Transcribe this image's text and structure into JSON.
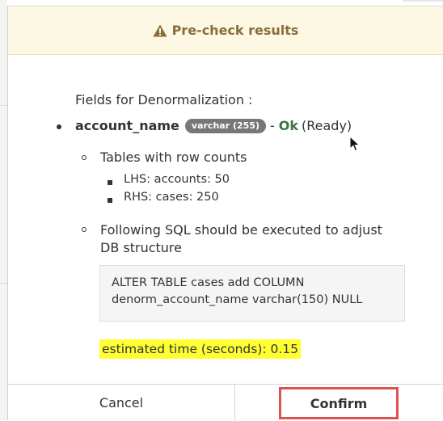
{
  "dialog": {
    "title": "Pre-check results",
    "section_title": "Fields for Denormalization :",
    "field": {
      "name": "account_name",
      "type_badge": "varchar (255)",
      "dash": "-",
      "status": "Ok",
      "status_note": "(Ready)"
    },
    "row_counts": {
      "heading": "Tables with row counts",
      "items": [
        "LHS: accounts: 50",
        "RHS: cases: 250"
      ]
    },
    "sql": {
      "heading": "Following SQL should be executed to adjust DB structure",
      "statement_line1": "ALTER TABLE cases add COLUMN",
      "statement_line2": "denorm_account_name varchar(150) NULL"
    },
    "estimated_time": "estimated time (seconds): 0.15",
    "buttons": {
      "cancel": "Cancel",
      "confirm": "Confirm"
    }
  },
  "colors": {
    "header_bg": "#fcf8e3",
    "header_text": "#8a6d3b",
    "ok_green": "#3c763d",
    "badge_gray": "#777777",
    "highlight_yellow": "#ffff33",
    "confirm_outline": "#d9534f"
  },
  "icons": {
    "header": "warning-triangle-icon",
    "cursor": "mouse-pointer-icon"
  }
}
